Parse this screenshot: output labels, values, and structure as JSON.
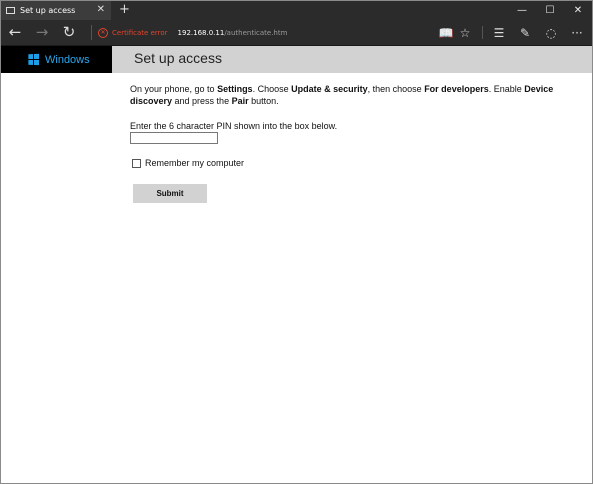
{
  "browser": {
    "tab_title": "Set up access",
    "new_tab_symbol": "+",
    "window_buttons": {
      "minimize": "—",
      "maximize": "☐",
      "close": "✕"
    },
    "nav": {
      "back": "←",
      "forward": "→",
      "refresh": "↻"
    },
    "cert_error": "Certificate error",
    "url_host": "192.168.0.11",
    "url_path": "/authenticate.htm",
    "tools": {
      "reading_view": "📖",
      "favorite": "☆",
      "hub": "☰",
      "web_note": "✎",
      "share": "◌"
    }
  },
  "header": {
    "brand_name": "Windows",
    "title": "Set up access"
  },
  "instructions": {
    "t1": "On your phone, go to ",
    "settings": "Settings",
    "t2": ". Choose ",
    "update_security": "Update & security",
    "t3": ", then choose ",
    "for_developers": "For developers",
    "t4": ". Enable ",
    "device_discovery": "Device discovery",
    "t5": " and press the ",
    "pair": "Pair",
    "t6": " button."
  },
  "form": {
    "pin_label": "Enter the 6 character PIN shown into the box below.",
    "pin_value": "",
    "remember_label": "Remember my computer",
    "remember_checked": false,
    "submit_label": "Submit"
  },
  "colors": {
    "brand_blue": "#1e9ee6",
    "cert_error_red": "#e0442c",
    "header_gray": "#d2d2d2",
    "browser_chrome": "#2b2b2b"
  }
}
